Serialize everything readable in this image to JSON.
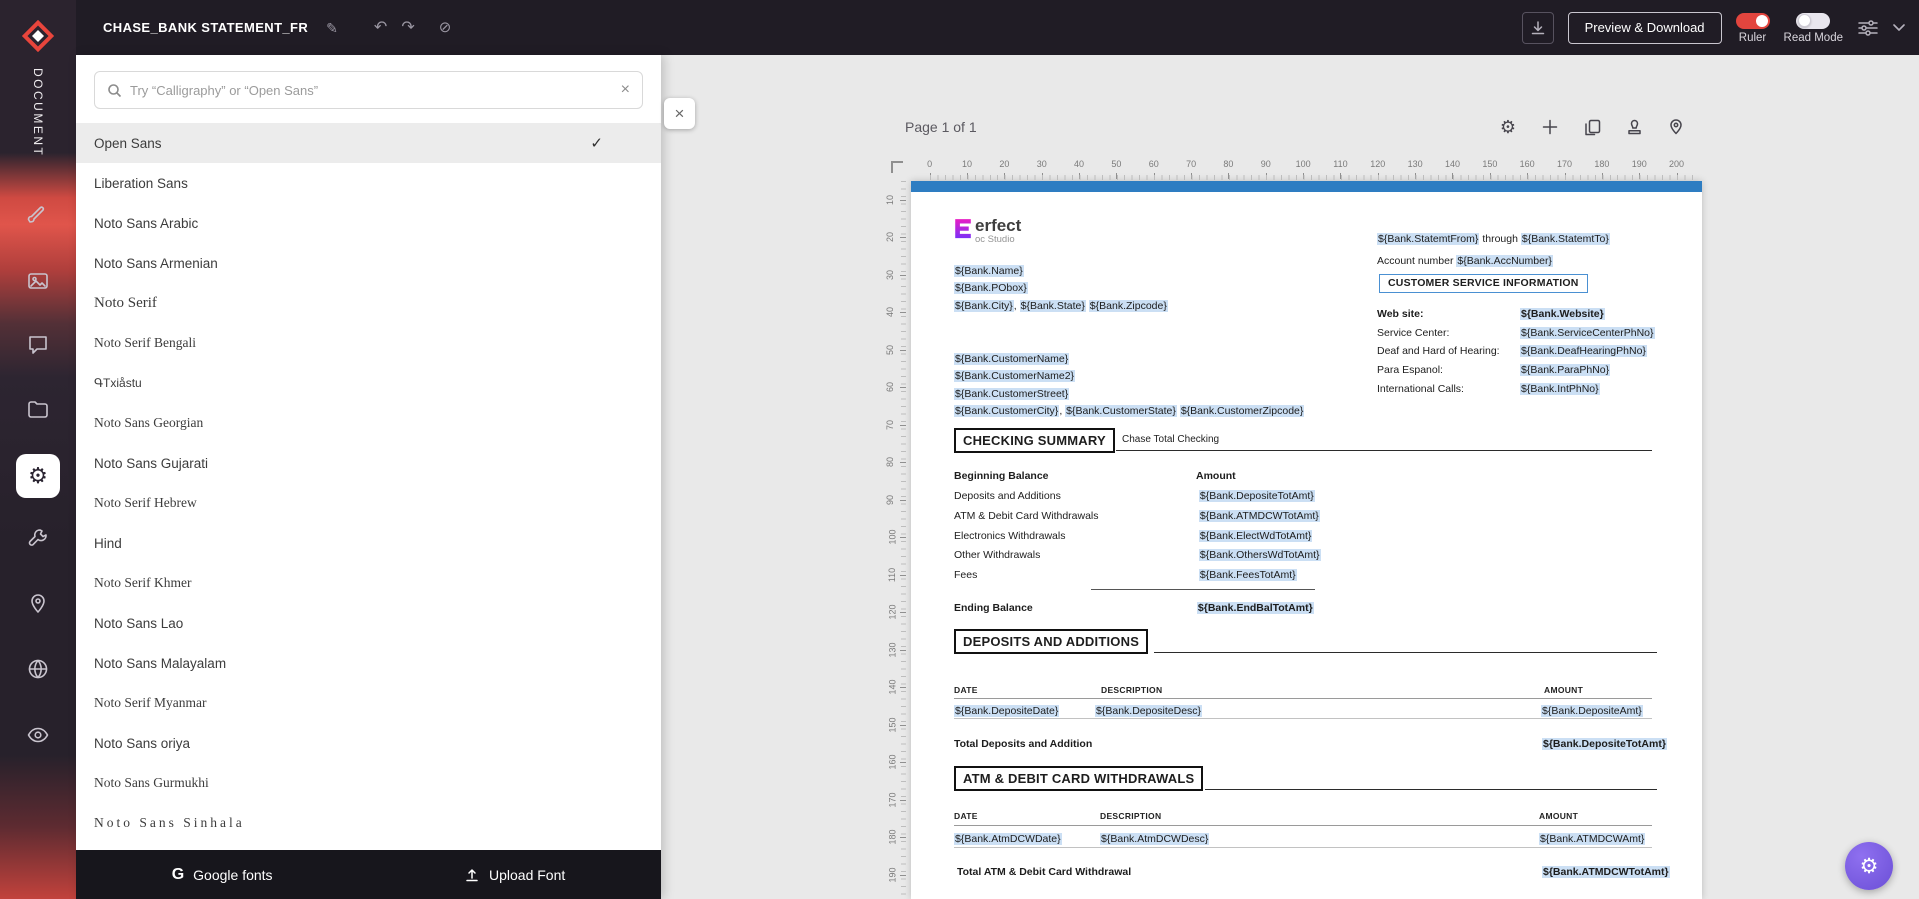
{
  "colors": {
    "accent_red": "#e2453e",
    "token_highlight": "#cbdff4",
    "page_header_bar": "#2e7dc2",
    "csi_border": "#4a90d2",
    "fab_purple": "#7b5fe6"
  },
  "glyphs": {
    "pencil": "✎",
    "undo": "↶",
    "redo": "↷",
    "disabled": "⊘",
    "gear": "⚙",
    "close": "×",
    "clear": "×",
    "check": "✓",
    "google_g": "G"
  },
  "topbar": {
    "title": "CHASE_BANK STATEMENT_FR",
    "preview_download": "Preview & Download",
    "ruler_label": "Ruler",
    "read_mode_label": "Read Mode"
  },
  "sidebar": {
    "label": "DOCUMENT"
  },
  "font_panel": {
    "search_placeholder": "Try “Calligraphy” or “Open Sans”",
    "fonts": [
      {
        "name": "Open Sans",
        "cls": "",
        "selected": true
      },
      {
        "name": "Liberation Sans",
        "cls": ""
      },
      {
        "name": "Noto Sans Arabic",
        "cls": ""
      },
      {
        "name": "Noto Sans Armenian",
        "cls": ""
      },
      {
        "name": "Noto Serif",
        "cls": "serif lg"
      },
      {
        "name": "Noto Serif Bengali",
        "cls": "serif"
      },
      {
        "name": "ԳTxiåstu",
        "cls": "sm"
      },
      {
        "name": "Noto Sans Georgian",
        "cls": "serif"
      },
      {
        "name": "Noto Sans Gujarati",
        "cls": ""
      },
      {
        "name": "Noto Serif Hebrew",
        "cls": "serif"
      },
      {
        "name": "Hind",
        "cls": ""
      },
      {
        "name": "Noto Serif Khmer",
        "cls": "serif"
      },
      {
        "name": "Noto Sans Lao",
        "cls": ""
      },
      {
        "name": "Noto Sans Malayalam",
        "cls": ""
      },
      {
        "name": "Noto Serif Myanmar",
        "cls": "serif"
      },
      {
        "name": "Noto Sans oriya",
        "cls": ""
      },
      {
        "name": "Noto Sans Gurmukhi",
        "cls": "serif"
      },
      {
        "name": "Noto  Sans  Sinhala",
        "cls": "serif sp"
      }
    ],
    "footer": {
      "google": "Google fonts",
      "upload": "Upload Font"
    }
  },
  "canvas": {
    "page_label": "Page 1 of 1",
    "ruler_h": [
      "0",
      "10",
      "20",
      "30",
      "40",
      "50",
      "60",
      "70",
      "80",
      "90",
      "100",
      "110",
      "120",
      "130",
      "140",
      "150",
      "160",
      "170",
      "180",
      "190",
      "200"
    ],
    "ruler_v": [
      "10",
      "20",
      "30",
      "40",
      "50",
      "60",
      "70",
      "80",
      "90",
      "100",
      "110",
      "120",
      "130",
      "140",
      "150",
      "160",
      "170",
      "180",
      "190"
    ]
  },
  "doc": {
    "logo_brand": "erfect",
    "logo_sub": "oc Studio",
    "comma": ",",
    "bank_name": "${Bank.Name}",
    "bank_pobox": "${Bank.PObox}",
    "bank_city": "${Bank.City}",
    "bank_state": "${Bank.State}",
    "bank_zip": "${Bank.Zipcode}",
    "stmt_from": "${Bank.StatemtFrom}",
    "stmt_through": "through",
    "stmt_to": "${Bank.StatemtTo}",
    "account_label": "Account number",
    "account_value": "${Bank.AccNumber}",
    "csi_title": "CUSTOMER SERVICE INFORMATION",
    "service_rows": [
      {
        "label": "Web site:",
        "value": "${Bank.Website}",
        "bold": true
      },
      {
        "label": "Service Center:",
        "value": "${Bank.ServiceCenterPhNo}"
      },
      {
        "label": "Deaf and Hard of Hearing:",
        "value": "${Bank.DeafHearingPhNo}"
      },
      {
        "label": "Para Espanol:",
        "value": "${Bank.ParaPhNo}"
      },
      {
        "label": "International Calls:",
        "value": "${Bank.IntPhNo}"
      }
    ],
    "cust_name": "${Bank.CustomerName}",
    "cust_name2": "${Bank.CustomerName2}",
    "cust_street": "${Bank.CustomerStreet}",
    "cust_city": "${Bank.CustomerCity}",
    "cust_state": "${Bank.CustomerState}",
    "cust_zip": "${Bank.CustomerZipcode}",
    "checking": {
      "title": "CHECKING SUMMARY",
      "subtitle": "Chase Total Checking",
      "col_label": "Beginning Balance",
      "col_amount": "Amount",
      "rows": [
        {
          "label": "Deposits and Additions",
          "value": "${Bank.DepositeTotAmt}"
        },
        {
          "label": "ATM & Debit Card Withdrawals",
          "value": "${Bank.ATMDCWTotAmt}"
        },
        {
          "label": "Electronics Withdrawals",
          "value": "${Bank.ElectWdTotAmt}"
        },
        {
          "label": "Other Withdrawals",
          "value": "${Bank.OthersWdTotAmt}"
        },
        {
          "label": "Fees",
          "value": "${Bank.FeesTotAmt}"
        }
      ],
      "ending_label": "Ending Balance",
      "ending_value": "${Bank.EndBalTotAmt}"
    },
    "deposits": {
      "title": "DEPOSITS AND ADDITIONS",
      "headers": [
        "DATE",
        "DESCRIPTION",
        "AMOUNT"
      ],
      "row": {
        "date": "${Bank.DepositeDate}",
        "desc": "${Bank.DepositeDesc}",
        "amount": "${Bank.DepositeAmt}"
      },
      "total_label": "Total Deposits and Addition",
      "total_value": "${Bank.DepositeTotAmt}"
    },
    "atm": {
      "title": "ATM & DEBIT CARD WITHDRAWALS",
      "headers": [
        "DATE",
        "DESCRIPTION",
        "AMOUNT"
      ],
      "row": {
        "date": "${Bank.AtmDCWDate}",
        "desc": "${Bank.AtmDCWDesc}",
        "amount": "${Bank.ATMDCWAmt}"
      },
      "total_label": "Total ATM & Debit Card Withdrawal",
      "total_value": "${Bank.ATMDCWTotAmt}"
    }
  }
}
